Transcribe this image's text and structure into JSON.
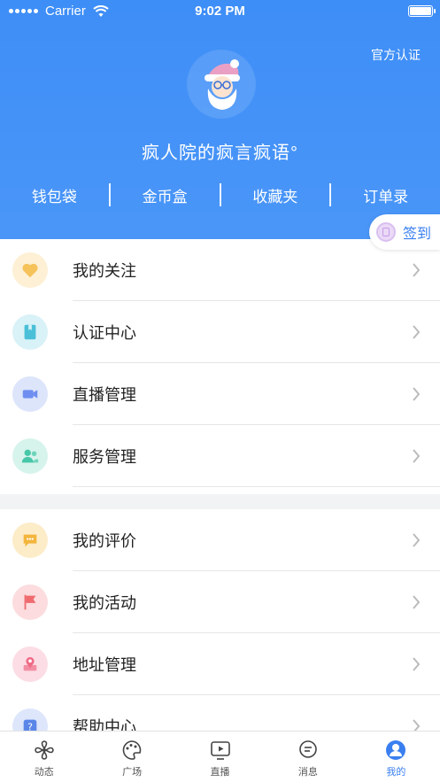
{
  "status_bar": {
    "carrier": "Carrier",
    "time": "9:02 PM"
  },
  "header": {
    "verify_link": "官方认证",
    "avatar_icon": "santa-avatar-icon",
    "username": "疯人院的疯言疯语°",
    "quick_links": [
      "钱包袋",
      "金币盒",
      "收藏夹",
      "订单录"
    ],
    "checkin_label": "签到",
    "bg_color": "#3e8ef7"
  },
  "menu_group_1": [
    {
      "label": "我的关注",
      "icon": "heart-icon",
      "color": "#f6c25a",
      "bg": "#fdf0d4"
    },
    {
      "label": "认证中心",
      "icon": "book-icon",
      "color": "#49c0d8",
      "bg": "#d9f2f7"
    },
    {
      "label": "直播管理",
      "icon": "video-camera-icon",
      "color": "#6e8ff0",
      "bg": "#dde5fb"
    },
    {
      "label": "服务管理",
      "icon": "users-icon",
      "color": "#46c7a8",
      "bg": "#d7f4ec"
    }
  ],
  "menu_group_2": [
    {
      "label": "我的评价",
      "icon": "chat-bubble-icon",
      "color": "#f3b53c",
      "bg": "#fcecc8"
    },
    {
      "label": "我的活动",
      "icon": "flag-icon",
      "color": "#ef6b70",
      "bg": "#fcdcde"
    },
    {
      "label": "地址管理",
      "icon": "location-pin-icon",
      "color": "#ef6b87",
      "bg": "#fcdde5"
    },
    {
      "label": "帮助中心",
      "icon": "help-icon",
      "color": "#5a86e8",
      "bg": "#dde6fb"
    }
  ],
  "tab_bar": [
    {
      "label": "动态",
      "icon": "pinwheel-icon",
      "active": false
    },
    {
      "label": "广场",
      "icon": "palette-icon",
      "active": false
    },
    {
      "label": "直播",
      "icon": "play-screen-icon",
      "active": false
    },
    {
      "label": "消息",
      "icon": "message-icon",
      "active": false
    },
    {
      "label": "我的",
      "icon": "profile-icon",
      "active": true
    }
  ],
  "accent_color": "#3a7ff0"
}
